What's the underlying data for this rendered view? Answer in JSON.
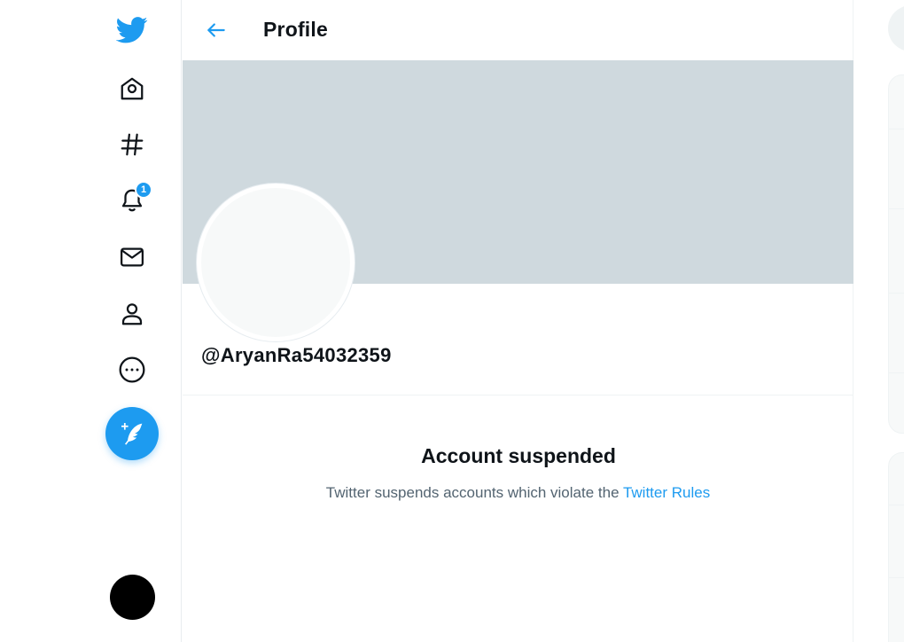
{
  "nav": {
    "notification_badge": "1",
    "items": [
      {
        "name": "twitter-logo-icon",
        "icon": "bird"
      },
      {
        "name": "home-icon",
        "icon": "home"
      },
      {
        "name": "explore-icon",
        "icon": "hashtag"
      },
      {
        "name": "notifications-icon",
        "icon": "bell"
      },
      {
        "name": "messages-icon",
        "icon": "envelope"
      },
      {
        "name": "profile-icon",
        "icon": "person"
      },
      {
        "name": "more-icon",
        "icon": "ellipsis-circle"
      }
    ],
    "compose_icon": "feather-plus"
  },
  "header": {
    "back_icon": "arrow-left",
    "title": "Profile"
  },
  "profile": {
    "handle": "@AryanRa54032359"
  },
  "suspended": {
    "title": "Account suspended",
    "message": "Twitter suspends accounts which violate the",
    "link_text": "Twitter Rules"
  },
  "colors": {
    "accent": "#1d9bf0",
    "banner": "#cfd9de",
    "secondary_text": "#536471"
  }
}
